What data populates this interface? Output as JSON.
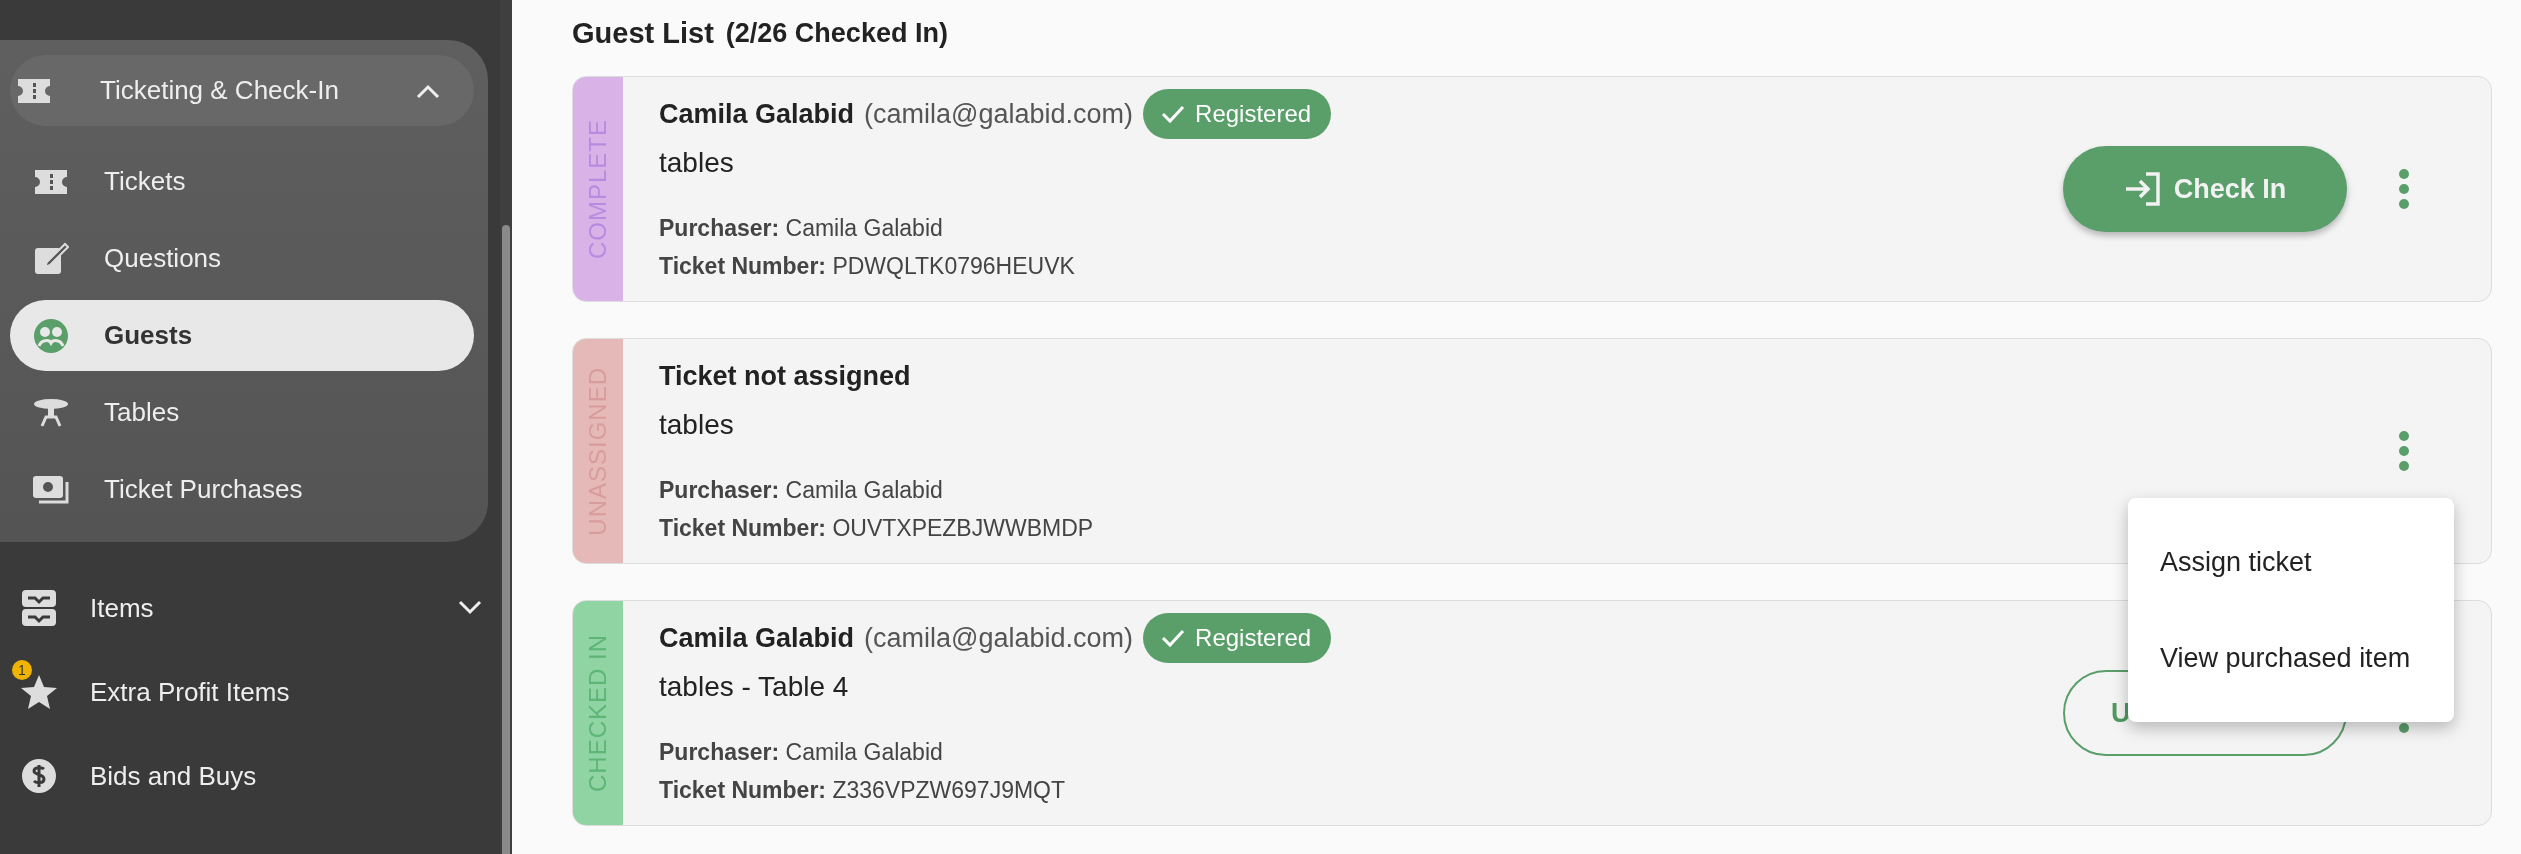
{
  "sidebar": {
    "group": {
      "label": "Ticketing & Check-In",
      "expanded": true,
      "items": [
        {
          "label": "Tickets",
          "selected": false
        },
        {
          "label": "Questions",
          "selected": false
        },
        {
          "label": "Guests",
          "selected": true
        },
        {
          "label": "Tables",
          "selected": false
        },
        {
          "label": "Ticket Purchases",
          "selected": false
        }
      ]
    },
    "items": [
      {
        "kind": "group",
        "label": "Items",
        "expanded": false
      },
      {
        "kind": "link",
        "label": "Extra Profit Items",
        "badge": "1"
      },
      {
        "kind": "link",
        "label": "Bids and Buys"
      }
    ]
  },
  "guest_list": {
    "title": "Guest List",
    "count": "(2/26 Checked In)",
    "cards": [
      {
        "status": {
          "kind": "complete",
          "label": "COMPLETE"
        },
        "name": "Camila Galabid",
        "email": "(camila@galabid.com)",
        "badge": "Registered",
        "ticket": "tables",
        "purchaser_label": "Purchaser:",
        "purchaser": "Camila Galabid",
        "ticket_number_label": "Ticket Number:",
        "ticket_number": "PDWQLTK0796HEUVK",
        "action": {
          "kind": "check_in",
          "label": "Check In"
        }
      },
      {
        "status": {
          "kind": "unassigned",
          "label": "UNASSIGNED"
        },
        "name": "Ticket not assigned",
        "ticket": "tables",
        "purchaser_label": "Purchaser:",
        "purchaser": "Camila Galabid",
        "ticket_number_label": "Ticket Number:",
        "ticket_number": "OUVTXPEZBJWWBMDP",
        "menu": {
          "items": [
            "Assign ticket",
            "View purchased item"
          ]
        }
      },
      {
        "status": {
          "kind": "checked_in",
          "label": "CHECKED IN"
        },
        "name": "Camila Galabid",
        "email": "(camila@galabid.com)",
        "badge": "Registered",
        "ticket": "tables - Table 4",
        "purchaser_label": "Purchaser:",
        "purchaser": "Camila Galabid",
        "ticket_number_label": "Ticket Number:",
        "ticket_number": "Z336VPZW697J9MQT",
        "action": {
          "kind": "undo",
          "label": "U"
        }
      }
    ]
  }
}
